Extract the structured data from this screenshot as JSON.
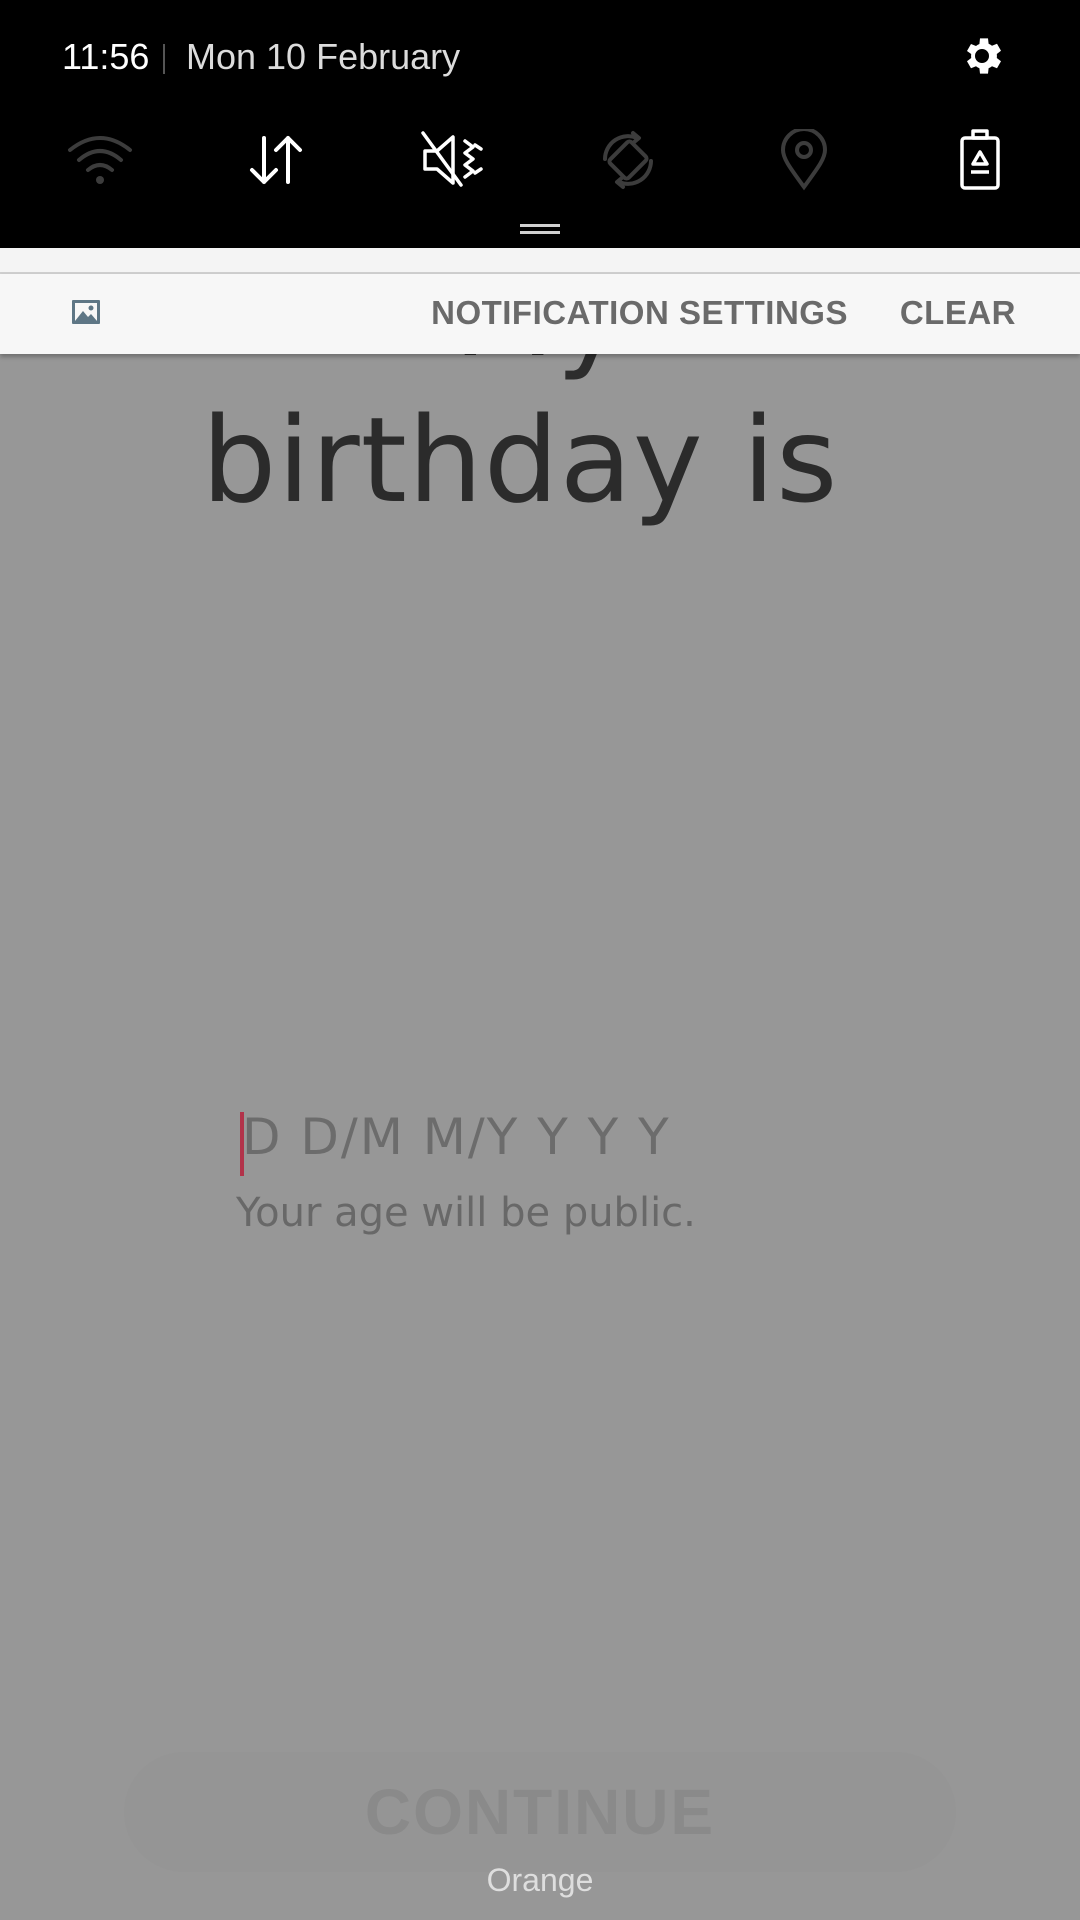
{
  "status_bar": {
    "time": "11:56",
    "date": "Mon 10 February"
  },
  "quick_settings": [
    {
      "icon": "wifi-icon",
      "state": "off"
    },
    {
      "icon": "mobile-data-icon",
      "state": "on"
    },
    {
      "icon": "mute-vibrate-icon",
      "state": "on"
    },
    {
      "icon": "auto-rotate-icon",
      "state": "off"
    },
    {
      "icon": "location-icon",
      "state": "off"
    },
    {
      "icon": "power-saving-icon",
      "state": "on"
    }
  ],
  "notification_bar": {
    "settings_label": "NOTIFICATION SETTINGS",
    "clear_label": "CLEAR"
  },
  "app": {
    "heading_partial": "My",
    "heading": "birthday is",
    "date_mask": "D D/M M/Y Y Y Y",
    "helper_text": "Your age will be public.",
    "continue_label": "CONTINUE",
    "carrier": "Orange"
  },
  "colors": {
    "accent_caret": "#b2334a",
    "overlay": "#979797",
    "shade": "#000000"
  }
}
